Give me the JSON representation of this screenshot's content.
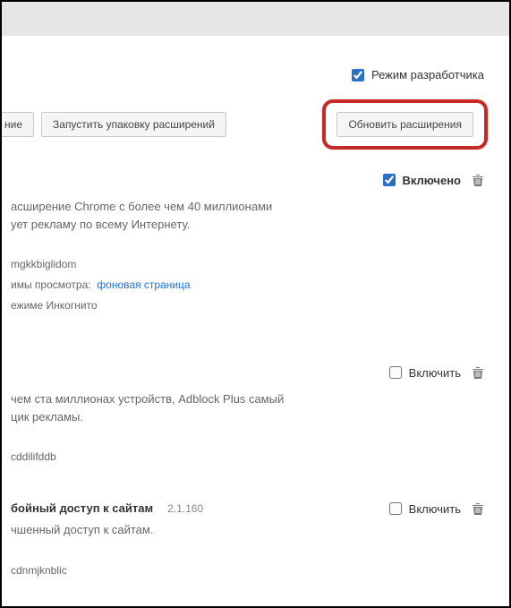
{
  "header": {
    "dev_mode_label": "Режим разработчика",
    "dev_mode_checked": true
  },
  "buttons": {
    "load_unpacked_partial": "ние",
    "pack_extension": "Запустить упаковку расширений",
    "update_extensions": "Обновить расширения"
  },
  "extensions": [
    {
      "enabled_checked": true,
      "enabled_label": "Включено",
      "desc_line1": "асширение Chrome с более чем 40 миллионами",
      "desc_line2": "ует рекламу по всему Интернету.",
      "id_partial": "mgkkbiglidom",
      "views_prefix": "имы просмотра:",
      "views_link": "фоновая страница",
      "incognito_line": "ежиме Инкогнито"
    },
    {
      "enabled_checked": false,
      "enabled_label": "Включить",
      "desc_line1": "чем ста миллионах устройств, Adblock Plus самый",
      "desc_line2": "цик рекламы.",
      "id_partial": "cddilifddb"
    },
    {
      "title_partial": "бойный доступ к сайтам",
      "version": "2.1.160",
      "enabled_checked": false,
      "enabled_label": "Включить",
      "desc_line1": "чшенный доступ к сайтам.",
      "id_partial": "cdnmjknblic"
    }
  ]
}
